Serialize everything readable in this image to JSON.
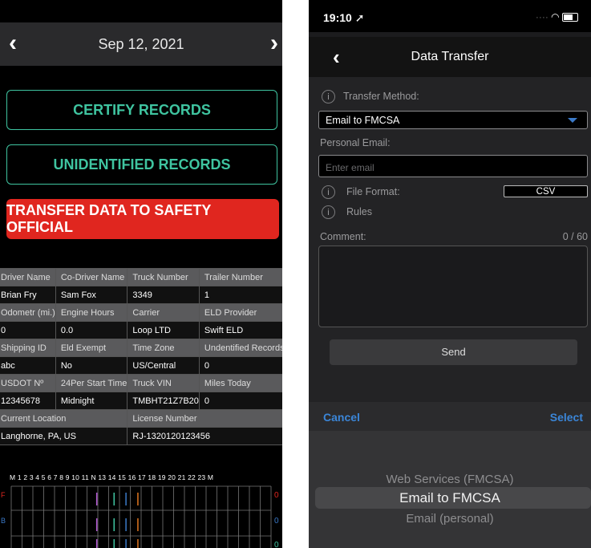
{
  "left": {
    "date": "Sep 12, 2021",
    "buttons": {
      "certify": "CERTIFY RECORDS",
      "unidentified": "UNIDENTIFIED RECORDS",
      "transfer": "TRANSFER DATA TO SAFETY OFFICIAL"
    },
    "table": [
      {
        "type": "hdr",
        "cells": [
          "Driver Name",
          "Co-Driver Name",
          "Truck Number",
          "Trailer Number"
        ]
      },
      {
        "type": "val",
        "cells": [
          "Brian Fry",
          "Sam Fox",
          "3349",
          "1"
        ]
      },
      {
        "type": "hdr",
        "cells": [
          "Odometr (mi.)",
          "Engine Hours",
          "Carrier",
          "ELD Provider"
        ]
      },
      {
        "type": "val",
        "cells": [
          "0",
          "0.0",
          "Loop LTD",
          "Swift ELD"
        ]
      },
      {
        "type": "hdr",
        "cells": [
          "Shipping ID",
          "Eld Exempt",
          "Time Zone",
          "Undentified Records"
        ]
      },
      {
        "type": "val",
        "cells": [
          "abc",
          "No",
          "US/Central",
          "0"
        ]
      },
      {
        "type": "hdr",
        "cells": [
          "USDOT Nº",
          "24Per Start Time",
          "Truck VIN",
          "Miles Today"
        ]
      },
      {
        "type": "val",
        "cells": [
          "12345678",
          "Midnight",
          "TMBHT21Z7B20",
          "0"
        ]
      },
      {
        "type": "hdr2",
        "cells": [
          "Current Location",
          "License Number"
        ]
      },
      {
        "type": "val2",
        "cells": [
          "Langhorne, PA, US",
          "RJ-1320120123456"
        ]
      }
    ],
    "graph_hours": "M 1 2 3 4 5 6 7 8 9 10 11 N 13 14 15 16 17 18 19 20 21 22 23 M",
    "graph_right_labels": [
      "0",
      "0",
      "0"
    ],
    "graph_left_labels": [
      "F",
      "B"
    ]
  },
  "right": {
    "status_time": "19:10 ➚",
    "title": "Data Transfer",
    "transfer_method_label": "Transfer Method:",
    "transfer_method_value": "Email to FMCSA",
    "personal_email_label": "Personal Email:",
    "email_placeholder": "Enter email",
    "file_format_label": "File Format:",
    "file_format_value": "CSV",
    "rules_label": "Rules",
    "comment_label": "Comment:",
    "comment_count": "0 / 60",
    "send_label": "Send",
    "cancel_label": "Cancel",
    "select_label": "Select",
    "picker_options": [
      "Web Services (FMCSA)",
      "Email to FMCSA",
      "Email (personal)"
    ],
    "picker_selected": 1
  },
  "colors": {
    "teal": "#3fc4a0",
    "red": "#e0261f",
    "ios_blue": "#3b86d8"
  }
}
